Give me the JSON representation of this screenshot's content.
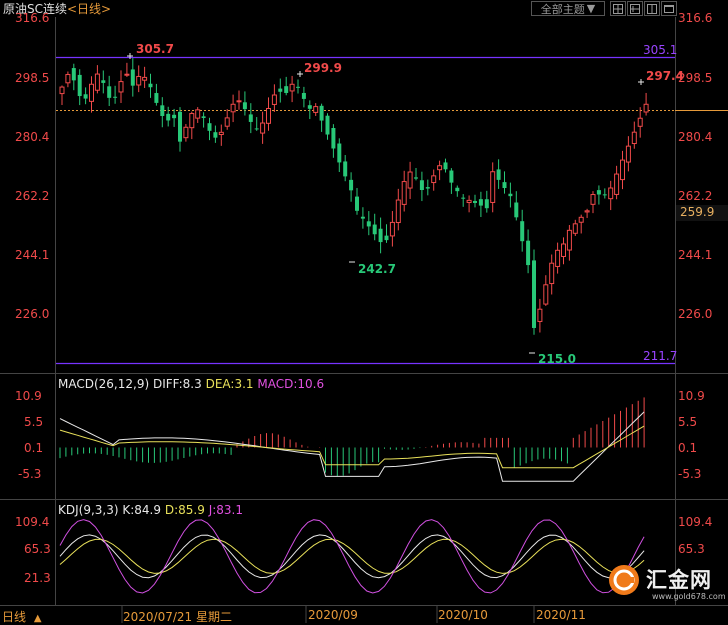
{
  "header": {
    "symbol": "原油SC连续",
    "period": "<日线>",
    "menu_label": "全部主题",
    "menu_arrow": "▼"
  },
  "price_axis": {
    "ticks": [
      "316.6",
      "298.5",
      "280.4",
      "262.2",
      "244.1",
      "226.0"
    ],
    "current_price": "259.9"
  },
  "annotations": {
    "high1": "305.7",
    "high2": "299.9",
    "low1": "242.7",
    "low2": "215.0",
    "recent_high": "297.4",
    "upper_line": "305.1",
    "lower_line": "211.7"
  },
  "macd": {
    "label": "MACD(26,12,9)",
    "diff": "DIFF:8.3",
    "dea": "DEA:3.1",
    "macd": "MACD:10.6",
    "ticks": [
      "10.9",
      "5.5",
      "0.1",
      "-5.3"
    ]
  },
  "kdj": {
    "label": "KDJ(9,3,3)",
    "k": "K:84.9",
    "d": "D:85.9",
    "j": "J:83.1",
    "ticks": [
      "109.4",
      "65.3",
      "21.3"
    ]
  },
  "time_axis": {
    "period_label": "日线",
    "cursor_date": "2020/07/21 星期二",
    "months": [
      "2020/09",
      "2020/10",
      "2020/11"
    ]
  },
  "watermark": {
    "brand": "汇金网",
    "url": "www.gold678.com"
  },
  "colors": {
    "up": "#f04a4a",
    "down": "#28c878",
    "band": "#7733ff",
    "ma": "#e69a3a"
  }
}
